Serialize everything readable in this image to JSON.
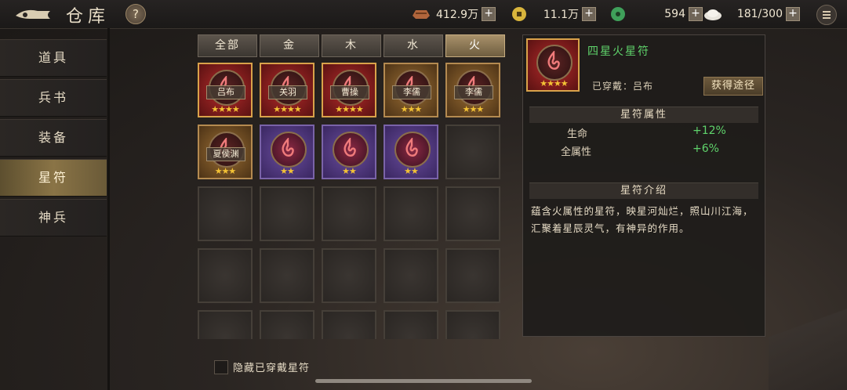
{
  "header": {
    "title": "仓库",
    "help": "?",
    "resources": [
      {
        "name": "copper",
        "icon": "ingot-icon",
        "value": "412.9万"
      },
      {
        "name": "coin",
        "icon": "coin-icon",
        "value": "11.1万"
      },
      {
        "name": "jade",
        "icon": "jade-icon",
        "value": "594"
      },
      {
        "name": "grain",
        "icon": "grain-icon",
        "value": "181/300"
      }
    ],
    "plus": "+"
  },
  "sidebar": {
    "items": [
      {
        "label": "道具",
        "active": false
      },
      {
        "label": "兵书",
        "active": false
      },
      {
        "label": "装备",
        "active": false
      },
      {
        "label": "星符",
        "active": true
      },
      {
        "label": "神兵",
        "active": false
      }
    ]
  },
  "tabs": [
    {
      "label": "全部",
      "active": false
    },
    {
      "label": "金",
      "active": false
    },
    {
      "label": "木",
      "active": false
    },
    {
      "label": "水",
      "active": false
    },
    {
      "label": "火",
      "active": true
    }
  ],
  "grid": {
    "items": [
      {
        "owner": "吕布",
        "stars": "★★★★",
        "rarity": "r4"
      },
      {
        "owner": "关羽",
        "stars": "★★★★",
        "rarity": "r4"
      },
      {
        "owner": "曹操",
        "stars": "★★★★",
        "rarity": "r4"
      },
      {
        "owner": "李儒",
        "stars": "★★★",
        "rarity": "r3"
      },
      {
        "owner": "李儒",
        "stars": "★★★",
        "rarity": "r3"
      },
      {
        "owner": "夏侯渊",
        "stars": "★★★",
        "rarity": "r3"
      },
      {
        "owner": "",
        "stars": "★★",
        "rarity": "r2"
      },
      {
        "owner": "",
        "stars": "★★",
        "rarity": "r2"
      },
      {
        "owner": "",
        "stars": "★★",
        "rarity": "r2"
      }
    ]
  },
  "footer": {
    "hide_label": "隐藏已穿戴星符"
  },
  "detail": {
    "name": "四星火星符",
    "stars": "★★★★",
    "worn_by": "已穿戴：吕布",
    "obtain_button": "获得途径",
    "attributes_title": "星符属性",
    "attributes": [
      {
        "label": "生命",
        "value": "+12%"
      },
      {
        "label": "全属性",
        "value": "+6%"
      }
    ],
    "intro_title": "星符介绍",
    "intro_text": "蕴含火属性的星符，映星河灿烂，照山川江海，汇聚着星辰灵气，有神异的作用。"
  }
}
